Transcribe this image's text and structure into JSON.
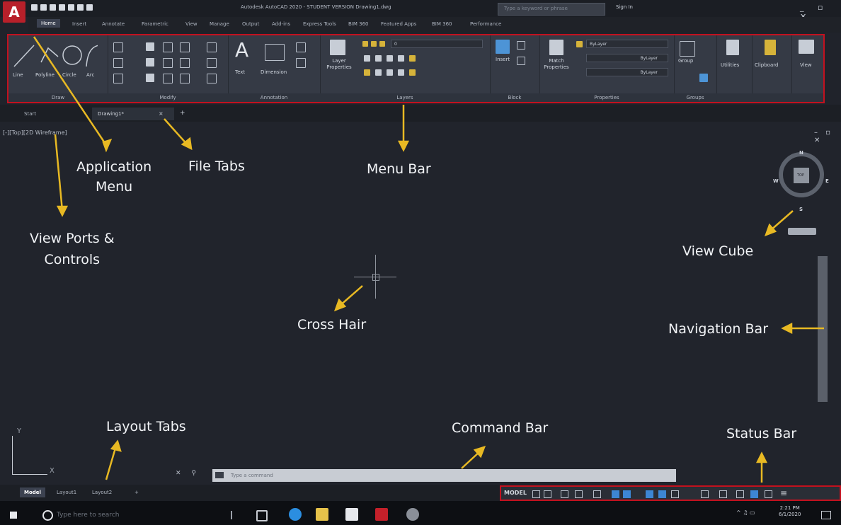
{
  "app": {
    "logo_letter": "A",
    "window_title": "Autodesk AutoCAD 2020 - STUDENT VERSION   Drawing1.dwg",
    "search_placeholder": "Type a keyword or phrase",
    "sign_in": "Sign In"
  },
  "ribbon": {
    "tabs": [
      "Home",
      "Insert",
      "Annotate",
      "Parametric",
      "View",
      "Manage",
      "Output",
      "Add-ins",
      "Express Tools",
      "BIM 360",
      "Featured Apps",
      "BIM 360",
      "Performance"
    ],
    "active_tab": "Home",
    "panels": {
      "draw": {
        "footer": "Draw",
        "tools": [
          "Line",
          "Polyline",
          "Circle",
          "Arc"
        ]
      },
      "modify": {
        "footer": "Modify"
      },
      "annotation": {
        "footer": "Annotation",
        "tools": [
          "Text",
          "Dimension"
        ]
      },
      "layers": {
        "footer": "Layers",
        "tools": [
          "Layer Properties"
        ],
        "layer_value": "0"
      },
      "block": {
        "footer": "Block",
        "tools": [
          "Insert"
        ]
      },
      "properties": {
        "footer": "Properties",
        "tools": [
          "Match Properties"
        ],
        "color": "ByLayer",
        "linetype": "ByLayer",
        "lineweight": "ByLayer"
      },
      "groups": {
        "footer": "Groups",
        "tools": [
          "Group"
        ]
      },
      "utilities": {
        "label": "Utilities"
      },
      "clipboard": {
        "label": "Clipboard"
      },
      "view": {
        "label": "View"
      }
    }
  },
  "file_tabs": [
    "Start",
    "Drawing1*"
  ],
  "viewport": {
    "label": "[-][Top][2D Wireframe]",
    "compass": {
      "n": "N",
      "s": "S",
      "e": "E",
      "w": "W"
    },
    "cube_face": "TOP",
    "ucs": {
      "x": "X",
      "y": "Y"
    }
  },
  "command": {
    "placeholder": "Type a command"
  },
  "layout_tabs": [
    "Model",
    "Layout1",
    "Layout2",
    "+"
  ],
  "status": {
    "model": "MODEL"
  },
  "taskbar": {
    "search": "Type here to search",
    "time": "2:21 PM",
    "date": "6/1/2020"
  },
  "annotations": {
    "application_menu": "Application\nMenu",
    "file_tabs": "File Tabs",
    "menu_bar": "Menu Bar",
    "view_ports": "View Ports &\nControls",
    "view_cube": "View Cube",
    "cross_hair": "Cross Hair",
    "navigation_bar": "Navigation Bar",
    "layout_tabs": "Layout Tabs",
    "command_bar": "Command Bar",
    "status_bar": "Status Bar"
  },
  "colors": {
    "highlight_border": "#c3111f",
    "arrow": "#e8b923",
    "app_button": "#b8202a"
  }
}
